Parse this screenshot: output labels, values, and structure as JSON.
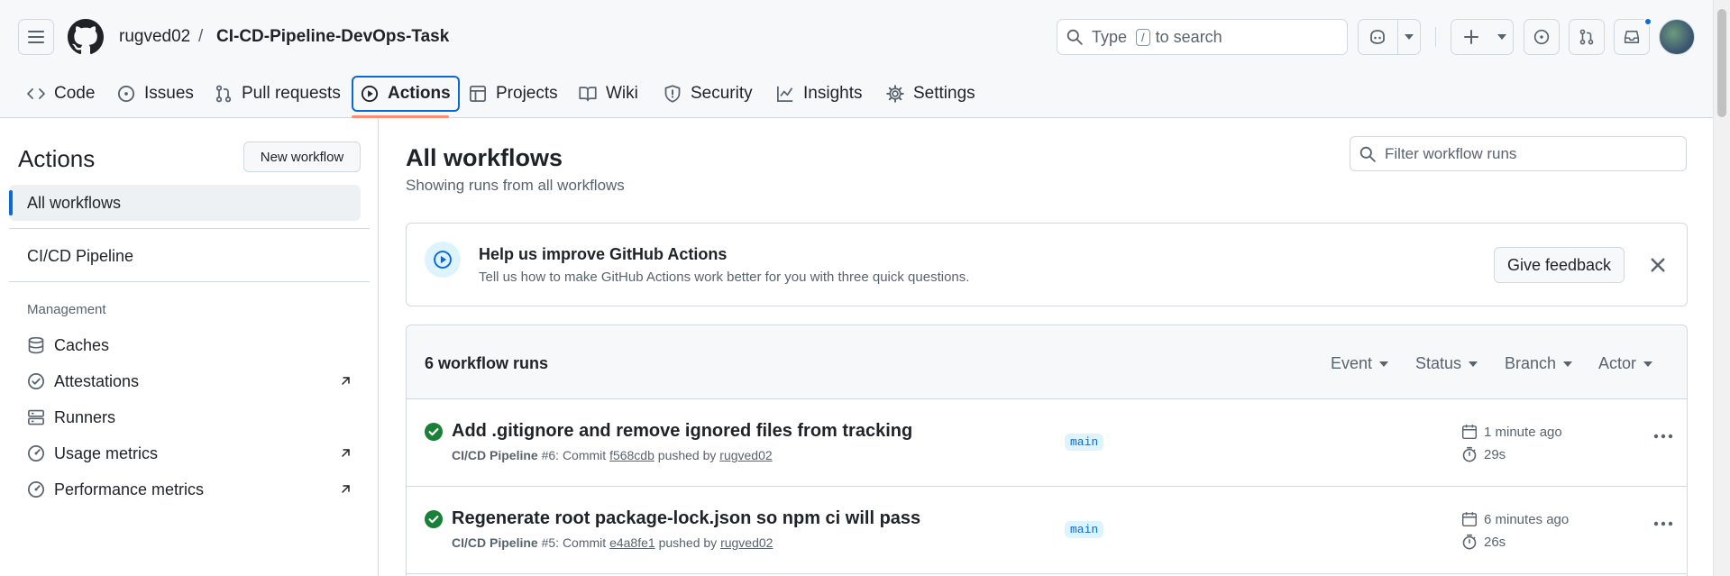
{
  "header": {
    "owner": "rugved02",
    "separator": "/",
    "repo": "CI-CD-Pipeline-DevOps-Task",
    "search": {
      "prefix": "Type",
      "key": "/",
      "suffix": "to search"
    }
  },
  "tabs": [
    {
      "label": "Code",
      "icon": "code-icon"
    },
    {
      "label": "Issues",
      "icon": "issue-icon"
    },
    {
      "label": "Pull requests",
      "icon": "pull-request-icon"
    },
    {
      "label": "Actions",
      "icon": "play-icon",
      "active": true
    },
    {
      "label": "Projects",
      "icon": "table-icon"
    },
    {
      "label": "Wiki",
      "icon": "book-icon"
    },
    {
      "label": "Security",
      "icon": "shield-icon"
    },
    {
      "label": "Insights",
      "icon": "graph-icon"
    },
    {
      "label": "Settings",
      "icon": "gear-icon"
    }
  ],
  "sidebar": {
    "title": "Actions",
    "new_workflow": "New workflow",
    "all_workflows": "All workflows",
    "workflows": [
      "CI/CD Pipeline"
    ],
    "management_heading": "Management",
    "management": [
      {
        "label": "Caches",
        "icon": "database-icon"
      },
      {
        "label": "Attestations",
        "icon": "verified-icon",
        "external": true
      },
      {
        "label": "Runners",
        "icon": "server-icon"
      },
      {
        "label": "Usage metrics",
        "icon": "meter-icon",
        "external": true
      },
      {
        "label": "Performance metrics",
        "icon": "meter-icon",
        "external": true
      }
    ]
  },
  "main": {
    "title": "All workflows",
    "subtitle": "Showing runs from all workflows",
    "filter_placeholder": "Filter workflow runs",
    "feedback": {
      "title": "Help us improve GitHub Actions",
      "description": "Tell us how to make GitHub Actions work better for you with three quick questions.",
      "button": "Give feedback"
    },
    "runs_count": "6 workflow runs",
    "filters": [
      "Event",
      "Status",
      "Branch",
      "Actor"
    ],
    "runs": [
      {
        "title": "Add .gitignore and remove ignored files from tracking",
        "workflow": "CI/CD Pipeline",
        "number": "#6",
        "commit_label": "Commit",
        "commit": "f568cdb",
        "pushed_by": "pushed by",
        "actor": "rugved02",
        "branch": "main",
        "when": "1 minute ago",
        "duration": "29s",
        "status": "success"
      },
      {
        "title": "Regenerate root package-lock.json so npm ci will pass",
        "workflow": "CI/CD Pipeline",
        "number": "#5",
        "commit_label": "Commit",
        "commit": "e4a8fe1",
        "pushed_by": "pushed by",
        "actor": "rugved02",
        "branch": "main",
        "when": "6 minutes ago",
        "duration": "26s",
        "status": "success"
      }
    ]
  },
  "colors": {
    "accent": "#0969da",
    "success": "#1a7f37",
    "tab_underline": "#fd8c73"
  }
}
